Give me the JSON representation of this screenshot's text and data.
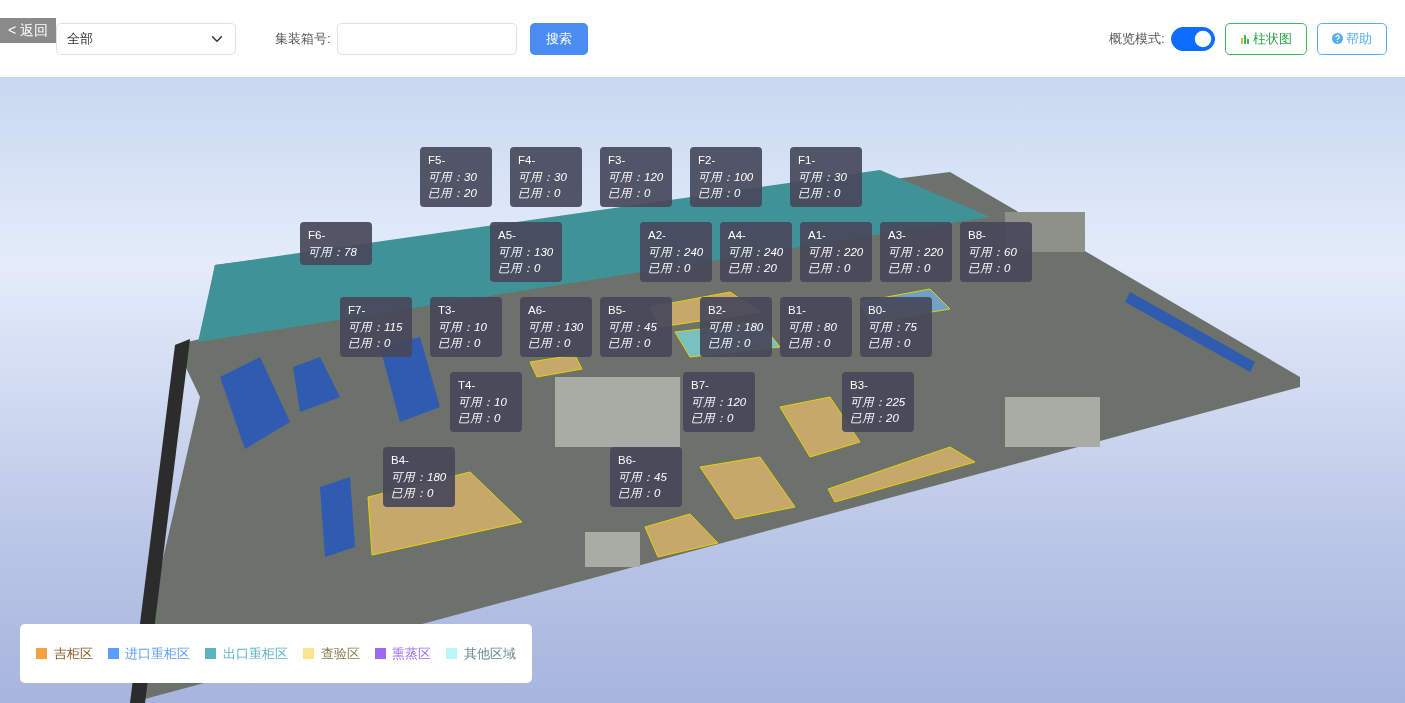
{
  "toolbar": {
    "back_button": "< 返回",
    "area_select": {
      "value": "全部"
    },
    "container_label": "集装箱号:",
    "search_button": "搜索",
    "overview_mode": {
      "label": "概览模式:",
      "on": true
    },
    "chart_button": "柱状图",
    "help_button": "帮助"
  },
  "areas": [
    {
      "name": "F5-",
      "available": "可用：30",
      "used": "已用：20"
    },
    {
      "name": "F4-",
      "available": "可用：30",
      "used": "已用：0"
    },
    {
      "name": "F3-",
      "available": "可用：120",
      "used": "已用：0"
    },
    {
      "name": "F2-",
      "available": "可用：100",
      "used": "已用：0"
    },
    {
      "name": "F1-",
      "available": "可用：30",
      "used": "已用：0"
    },
    {
      "name": "F6-",
      "available": "可用：78"
    },
    {
      "name": "A5-",
      "available": "可用：130",
      "used": "已用：0"
    },
    {
      "name": "A2-",
      "available": "可用：240",
      "used": "已用：0"
    },
    {
      "name": "A4-",
      "available": "可用：240",
      "used": "已用：20"
    },
    {
      "name": "A1-",
      "available": "可用：220",
      "used": "已用：0"
    },
    {
      "name": "A3-",
      "available": "可用：220",
      "used": "已用：0"
    },
    {
      "name": "B8-",
      "available": "可用：60",
      "used": "已用：0"
    },
    {
      "name": "F7-",
      "available": "可用：115",
      "used": "已用：0"
    },
    {
      "name": "T3-",
      "available": "可用：10",
      "used": "已用：0"
    },
    {
      "name": "A6-",
      "available": "可用：130",
      "used": "已用：0"
    },
    {
      "name": "B5-",
      "available": "可用：45",
      "used": "已用：0"
    },
    {
      "name": "B2-",
      "available": "可用：180",
      "used": "已用：0"
    },
    {
      "name": "B1-",
      "available": "可用：80",
      "used": "已用：0"
    },
    {
      "name": "B0-",
      "available": "可用：75",
      "used": "已用：0"
    },
    {
      "name": "T4-",
      "available": "可用：10",
      "used": "已用：0"
    },
    {
      "name": "B7-",
      "available": "可用：120",
      "used": "已用：0"
    },
    {
      "name": "B3-",
      "available": "可用：225",
      "used": "已用：20"
    },
    {
      "name": "B4-",
      "available": "可用：180",
      "used": "已用：0"
    },
    {
      "name": "B6-",
      "available": "可用：45",
      "used": "已用：0"
    }
  ],
  "legend": [
    {
      "label": "吉柜区",
      "color": "#f5a142"
    },
    {
      "label": "进口重柜区",
      "color": "#5b9ef7"
    },
    {
      "label": "出口重柜区",
      "color": "#5bb5c0"
    },
    {
      "label": "查验区",
      "color": "#fbe48e"
    },
    {
      "label": "熏蒸区",
      "color": "#9b6af2"
    },
    {
      "label": "其他区域",
      "color": "#b8f8fb"
    }
  ]
}
